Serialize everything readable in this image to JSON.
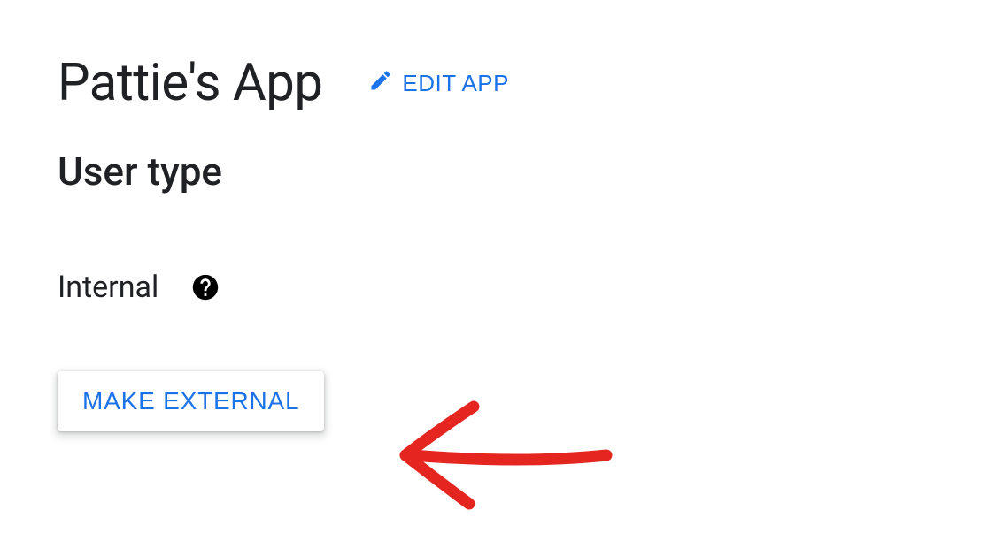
{
  "header": {
    "app_title": "Pattie's App",
    "edit_label": "EDIT APP"
  },
  "section": {
    "heading": "User type",
    "status_label": "Internal",
    "help_icon": "help-icon"
  },
  "actions": {
    "make_external_label": "MAKE EXTERNAL"
  },
  "annotation": {
    "arrow_color": "#e52620"
  }
}
